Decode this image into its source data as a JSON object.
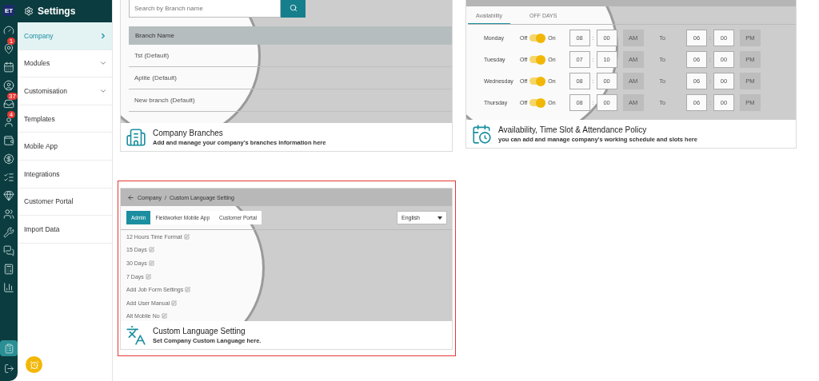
{
  "rail": {
    "logo": "ET",
    "icons": [
      {
        "kind": "gauge"
      },
      {
        "kind": "pin",
        "badge": "1"
      },
      {
        "kind": "calendar"
      },
      {
        "kind": "user-pin"
      },
      {
        "kind": "inbox",
        "badge": "37"
      },
      {
        "kind": "user",
        "badge": "4"
      },
      {
        "kind": "wallet"
      },
      {
        "kind": "dollar"
      },
      {
        "kind": "list"
      },
      {
        "kind": "gem"
      },
      {
        "kind": "users"
      },
      {
        "kind": "tools"
      },
      {
        "kind": "chat"
      },
      {
        "kind": "calculator"
      },
      {
        "kind": "chart"
      }
    ],
    "bottom": [
      {
        "kind": "settings-list",
        "selected": true
      },
      {
        "kind": "logout",
        "selected": false
      }
    ]
  },
  "sidebar": {
    "title": "Settings",
    "items": [
      {
        "label": "Company",
        "selected": true,
        "kind": "link"
      },
      {
        "label": "Modules",
        "selected": false,
        "kind": "group"
      },
      {
        "label": "Customisation",
        "selected": false,
        "kind": "group"
      },
      {
        "label": "Templates",
        "selected": false,
        "kind": "plain"
      },
      {
        "label": "Mobile App",
        "selected": false,
        "kind": "plain"
      },
      {
        "label": "Integrations",
        "selected": false,
        "kind": "plain"
      },
      {
        "label": "Customer Portal",
        "selected": false,
        "kind": "plain"
      },
      {
        "label": "Import Data",
        "selected": false,
        "kind": "plain"
      }
    ]
  },
  "cards": [
    {
      "kind": "branches",
      "highlighted": false,
      "title": "Company Branches",
      "description": "Add and manage your company's branches information here",
      "preview": {
        "search_placeholder": "Search by Branch name",
        "column": "Branch Name",
        "rows": [
          "Tst (Default)",
          "Aplite (Default)",
          "New branch (Default)"
        ]
      }
    },
    {
      "kind": "availability",
      "highlighted": false,
      "title": "Availability, Time Slot & Attendance Policy",
      "description": "you can add and manage company's working schedule and slots here",
      "preview": {
        "tabs": [
          {
            "label": "Availability",
            "selected": true
          },
          {
            "label": "OFF DAYS",
            "selected": false
          }
        ],
        "days": [
          {
            "day": "Monday",
            "off_label": "Off",
            "on": true,
            "on_label": "On",
            "from_hour": "08",
            "sep1": ":",
            "from_min": "00",
            "from_ampm": "AM",
            "to_label": "To",
            "to_hour": "06",
            "sep2": ":",
            "to_min": "00",
            "to_ampm": "PM"
          },
          {
            "day": "Tuesday",
            "off_label": "Off",
            "on": true,
            "on_label": "On",
            "from_hour": "07",
            "sep1": ":",
            "from_min": "10",
            "from_ampm": "AM",
            "to_label": "To",
            "to_hour": "06",
            "sep2": ":",
            "to_min": "00",
            "to_ampm": "PM"
          },
          {
            "day": "Wednesday",
            "off_label": "Off",
            "on": true,
            "on_label": "On",
            "from_hour": "08",
            "sep1": ":",
            "from_min": "00",
            "from_ampm": "AM",
            "to_label": "To",
            "to_hour": "06",
            "sep2": ":",
            "to_min": "00",
            "to_ampm": "PM"
          },
          {
            "day": "Thursday",
            "off_label": "Off",
            "on": true,
            "on_label": "On",
            "from_hour": "08",
            "sep1": ":",
            "from_min": "00",
            "from_ampm": "AM",
            "to_label": "To",
            "to_hour": "06",
            "sep2": ":",
            "to_min": "00",
            "to_ampm": "PM"
          }
        ]
      }
    },
    {
      "kind": "language",
      "highlighted": true,
      "title": "Custom Language Setting",
      "description": "Set Company Custom Language here.",
      "preview": {
        "breadcrumb": [
          "Company",
          "/",
          "Custom Language Setting"
        ],
        "tabs": [
          {
            "label": "Admin",
            "selected": true
          },
          {
            "label": "Fieldworker Mobile App",
            "selected": false
          },
          {
            "label": "Customer Portal",
            "selected": false
          }
        ],
        "language": "English",
        "items": [
          "12 Hours Time Format",
          "15 Days",
          "30 Days",
          "7 Days",
          "Add Job Form Settings",
          "Add User Manual",
          "Alt Mobile No"
        ]
      }
    }
  ]
}
